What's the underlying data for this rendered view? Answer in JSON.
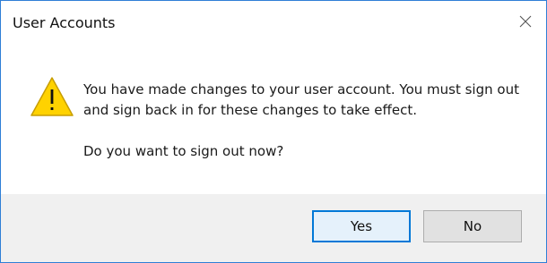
{
  "window": {
    "title": "User Accounts",
    "close_icon": "close-icon"
  },
  "message": {
    "icon": "warning-icon",
    "text": "You have made changes to your user account. You must sign out and sign back in for these changes to take effect.",
    "question": "Do you want to sign out now?"
  },
  "buttons": {
    "yes": "Yes",
    "no": "No"
  },
  "colors": {
    "accent": "#0078d7",
    "warning_fill": "#ffd200",
    "warning_stroke": "#b38a00",
    "footer_bg": "#f0f0f0"
  }
}
